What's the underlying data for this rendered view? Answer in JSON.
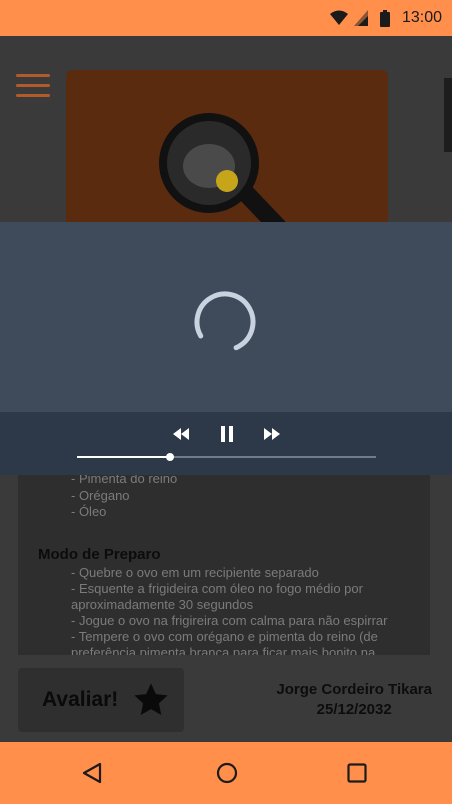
{
  "status_bar": {
    "time": "13:00",
    "icons": [
      "wifi-icon",
      "signal-icon",
      "battery-icon"
    ]
  },
  "menu": {
    "icon": "hamburger-icon"
  },
  "content": {
    "ingredients": [
      "- Pimenta do reino",
      "- Orégano",
      "- Óleo"
    ],
    "preparation_heading": "Modo de Preparo",
    "steps": [
      "- Quebre o ovo em um recipiente separado",
      "- Esquente a frigideira com óleo no fogo médio por",
      "aproximadamente 30 segundos",
      "- Jogue o ovo na frigireira com calma para não espirrar",
      "- Tempere o ovo com orégano e pimenta do reino (de",
      "preferência pimenta branca para ficar mais bonito na"
    ]
  },
  "rate": {
    "label": "Avaliar!",
    "icon": "star-icon"
  },
  "author": {
    "name": "Jorge Cordeiro Tikara",
    "date": "25/12/2032"
  },
  "player": {
    "state": "loading",
    "progress": 0.31,
    "controls": [
      "rewind-icon",
      "pause-icon",
      "fast-forward-icon"
    ]
  },
  "nav_bar": {
    "buttons": [
      "back-icon",
      "home-icon",
      "recents-icon"
    ]
  },
  "colors": {
    "accent": "#ff8f4a",
    "overlay": "#3f4a5b",
    "controls_bg": "#2d3848"
  }
}
